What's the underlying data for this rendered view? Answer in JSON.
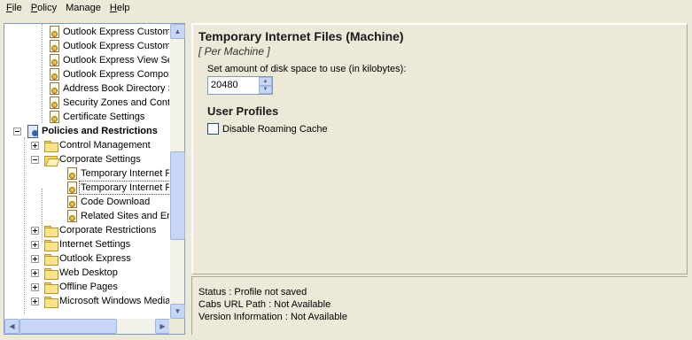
{
  "menu": [
    {
      "key": "F",
      "rest": "ile"
    },
    {
      "key": "P",
      "rest": "olicy"
    },
    {
      "key": "M",
      "rest": "anage"
    },
    {
      "key": "H",
      "rest": "elp"
    }
  ],
  "tree": {
    "items": [
      {
        "label": "Outlook Express Custom",
        "icon": "doc-icon"
      },
      {
        "label": "Outlook Express Custom",
        "icon": "doc-icon"
      },
      {
        "label": "Outlook Express View Set",
        "icon": "doc-icon"
      },
      {
        "label": "Outlook Express Compose",
        "icon": "doc-icon"
      },
      {
        "label": "Address Book Directory S",
        "icon": "doc-icon"
      },
      {
        "label": "Security Zones and Conte",
        "icon": "doc-icon"
      },
      {
        "label": "Certificate Settings",
        "icon": "doc-icon"
      },
      {
        "label": "Policies and Restrictions",
        "icon": "policy-icon",
        "expanded": true,
        "bold": true
      },
      {
        "label": "Control Management",
        "icon": "folder-icon",
        "expanded": false
      },
      {
        "label": "Corporate Settings",
        "icon": "folder-open-icon",
        "expanded": true
      },
      {
        "label": "Temporary Internet F",
        "icon": "doc-icon"
      },
      {
        "label": "Temporary Internet F",
        "icon": "doc-icon",
        "selected": true
      },
      {
        "label": "Code Download",
        "icon": "doc-icon"
      },
      {
        "label": "Related Sites and Err",
        "icon": "doc-icon"
      },
      {
        "label": "Corporate Restrictions",
        "icon": "folder-icon",
        "expanded": false
      },
      {
        "label": "Internet Settings",
        "icon": "folder-icon",
        "expanded": false
      },
      {
        "label": "Outlook Express",
        "icon": "folder-icon",
        "expanded": false
      },
      {
        "label": "Web Desktop",
        "icon": "folder-icon",
        "expanded": false
      },
      {
        "label": "Offline Pages",
        "icon": "folder-icon",
        "expanded": false
      },
      {
        "label": "Microsoft Windows Media",
        "icon": "folder-icon",
        "expanded": false
      }
    ]
  },
  "settings": {
    "title": "Temporary Internet Files (Machine)",
    "subtitle": "[ Per Machine ]",
    "disk_space_label": "Set amount of disk space to use (in kilobytes):",
    "disk_space_value": "20480",
    "user_profiles_title": "User Profiles",
    "disable_roaming_label": "Disable Roaming Cache",
    "disable_roaming_checked": false
  },
  "status": {
    "status_line": "Status : Profile not saved",
    "cabs_line": "Cabs URL Path : Not Available",
    "version_line": "Version Information : Not Available"
  },
  "colors": {
    "window_bg": "#ece9d8",
    "scrollbar_blue": "#c7d6f5",
    "border_blue": "#7f9db9"
  }
}
